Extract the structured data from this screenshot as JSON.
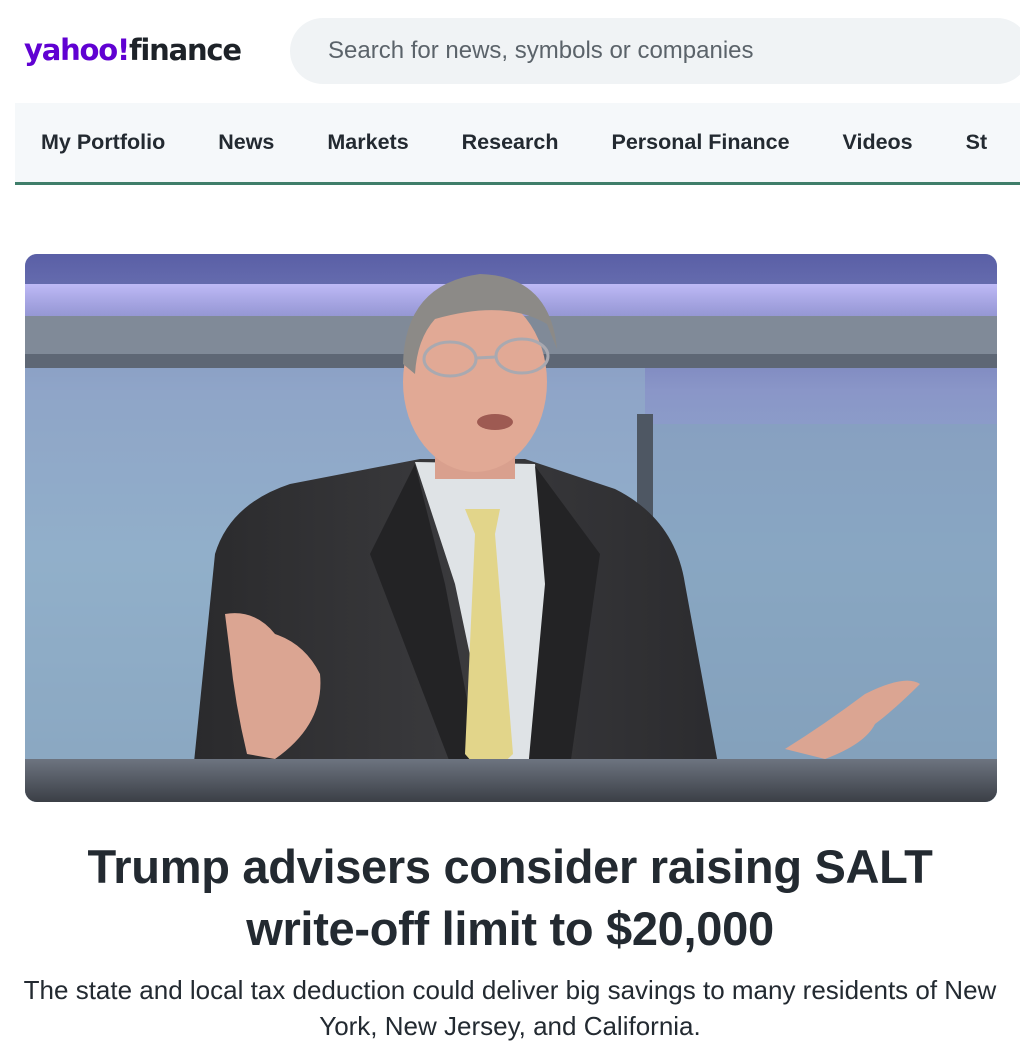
{
  "header": {
    "logo_brand": "yahoo!",
    "logo_product": "finance",
    "search_placeholder": "Search for news, symbols or companies"
  },
  "nav": {
    "items": [
      "My Portfolio",
      "News",
      "Markets",
      "Research",
      "Personal Finance",
      "Videos",
      "St"
    ]
  },
  "article": {
    "headline": "Trump advisers consider raising SALT write-off limit to $20,000",
    "subheadline": "The state and local tax deduction could deliver big savings to many residents of New York, New Jersey, and California."
  },
  "colors": {
    "brand": "#6001d2",
    "nav_underline": "#3f7e6a",
    "text": "#232a31"
  }
}
